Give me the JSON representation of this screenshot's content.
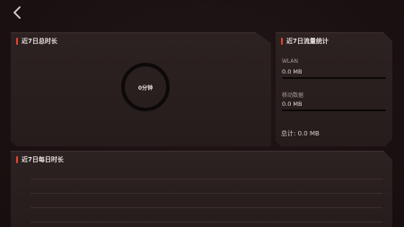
{
  "nav": {
    "back_icon": "chevron-left-icon"
  },
  "total_panel": {
    "title": "近7日总时长",
    "ring_value": "0分钟",
    "accent": "#e0452f"
  },
  "traffic_panel": {
    "title": "近7日流量统计",
    "wlan_label": "WLAN",
    "wlan_value": "0.0 MB",
    "wlan_fill": 0,
    "mobile_label": "移动数据",
    "mobile_value": "0.0 MB",
    "mobile_fill": 0,
    "total_label": "总计: 0.0 MB"
  },
  "daily_panel": {
    "title": "近7日每日时长"
  }
}
